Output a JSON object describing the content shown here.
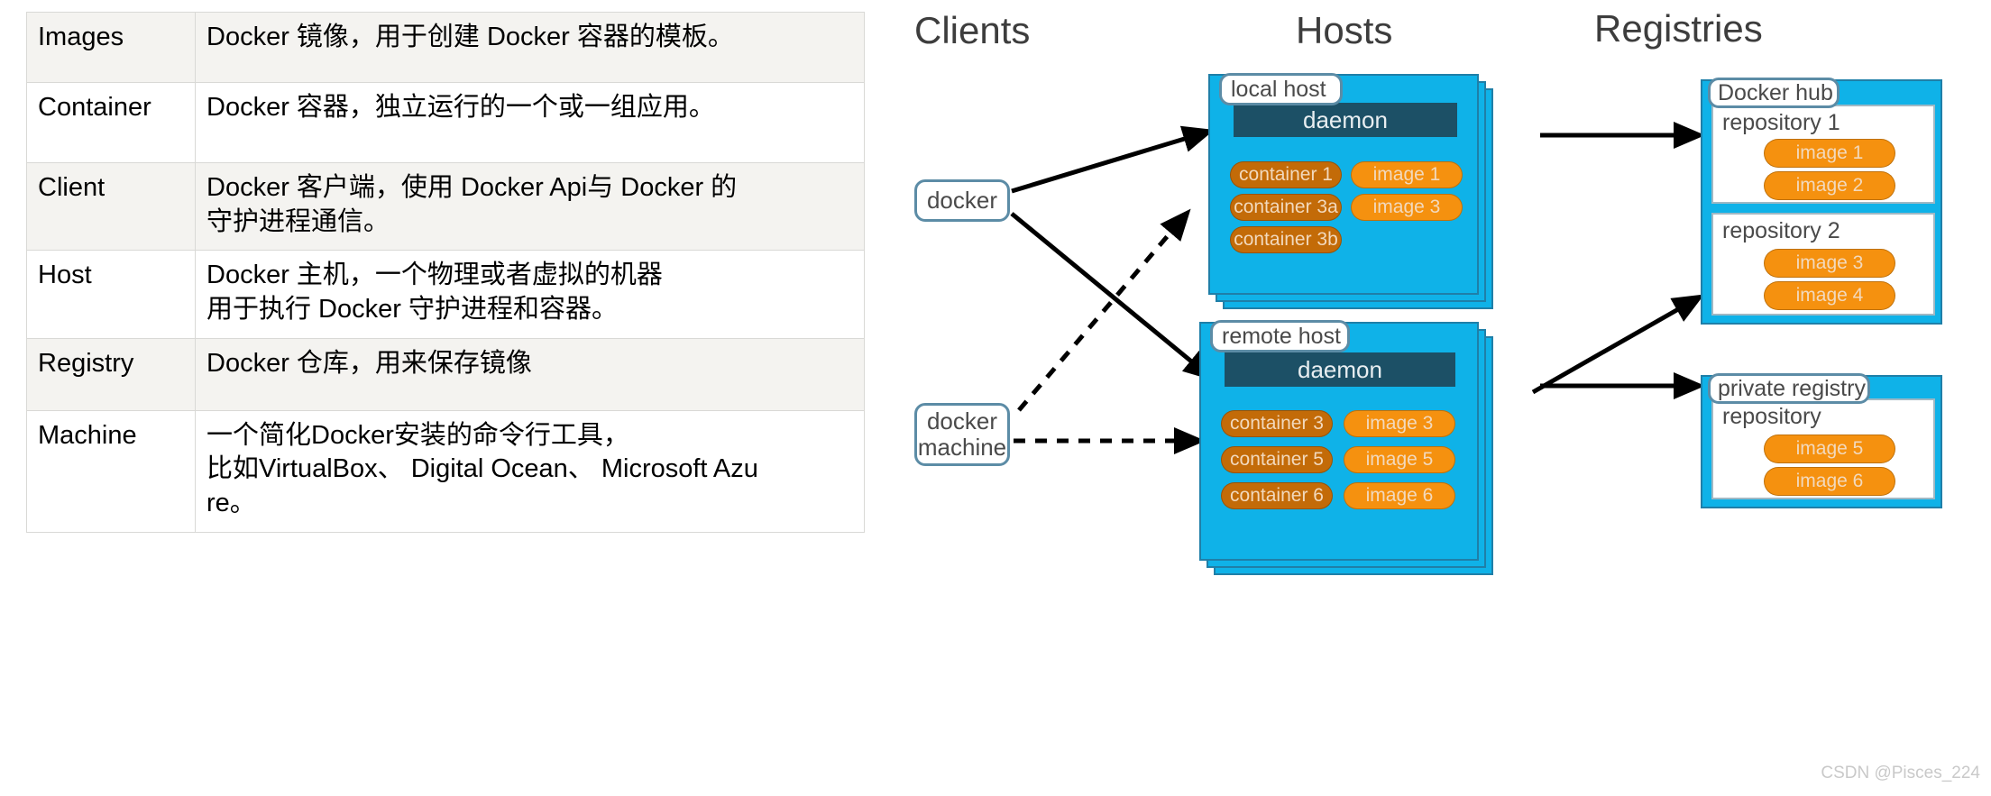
{
  "table": {
    "rows": [
      {
        "term": "Images",
        "desc": "Docker 镜像，用于创建 Docker 容器的模板。"
      },
      {
        "term": "Container",
        "desc": "Docker 容器，独立运行的一个或一组应用。"
      },
      {
        "term": "Client",
        "desc": "Docker 客户端，使用 Docker Api与 Docker 的\n守护进程通信。"
      },
      {
        "term": "Host",
        "desc": "Docker 主机，一个物理或者虚拟的机器\n用于执行 Docker 守护进程和容器。"
      },
      {
        "term": "Registry",
        "desc": "Docker 仓库，用来保存镜像"
      },
      {
        "term": "Machine",
        "desc": "一个简化Docker安装的命令行工具，\n比如VirtualBox、 Digital Ocean、 Microsoft Azu\nre。"
      }
    ]
  },
  "diagram": {
    "titles": {
      "clients": "Clients",
      "hosts": "Hosts",
      "registries": "Registries"
    },
    "clients": [
      {
        "id": "docker",
        "label": "docker"
      },
      {
        "id": "docker-machine",
        "line1": "docker",
        "line2": "machine"
      }
    ],
    "hosts": [
      {
        "id": "local-host",
        "tab_label": "local host",
        "daemon_label": "daemon",
        "containers": [
          "container 1",
          "container 3a",
          "container 3b"
        ],
        "images": [
          "image 1",
          "image 3"
        ]
      },
      {
        "id": "remote-host",
        "tab_label": "remote host",
        "daemon_label": "daemon",
        "containers": [
          "container 3",
          "container 5",
          "container 6"
        ],
        "images": [
          "image 3",
          "image 5",
          "image 6"
        ]
      }
    ],
    "registries": [
      {
        "id": "docker-hub",
        "tab_label": "Docker hub",
        "repositories": [
          {
            "label": "repository 1",
            "images": [
              "image 1",
              "image 2"
            ]
          },
          {
            "label": "repository 2",
            "images": [
              "image 3",
              "image 4"
            ]
          }
        ]
      },
      {
        "id": "private-registry",
        "tab_label": "private registry",
        "repositories": [
          {
            "label": "repository",
            "images": [
              "image 5",
              "image 6"
            ]
          }
        ]
      }
    ],
    "colors": {
      "host_blue": "#0fb2e8",
      "daemon_teal": "#1c5066",
      "container_orange": "#c36b08",
      "image_orange": "#f5910f",
      "outline_blue": "#5c8ca6"
    }
  },
  "watermark": "CSDN @Pisces_224"
}
